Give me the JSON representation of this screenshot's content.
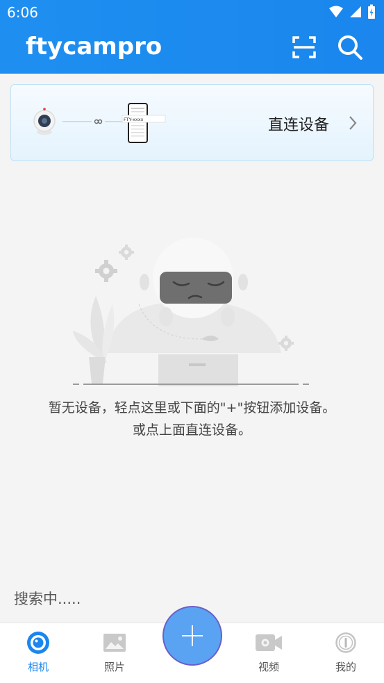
{
  "status_bar": {
    "time": "6:06"
  },
  "app_bar": {
    "title": "ftycampro"
  },
  "direct_connect": {
    "label": "直连设备",
    "phone_text": "FTY-xxxx"
  },
  "empty_state": {
    "line1": "暂无设备，轻点这里或下面的\"+\"按钮添加设备。",
    "line2": "或点上面直连设备。"
  },
  "search_status": "搜索中.....",
  "bottom_nav": {
    "items": [
      {
        "label": "相机",
        "icon": "camera-icon",
        "active": true
      },
      {
        "label": "照片",
        "icon": "photo-icon",
        "active": false
      },
      {
        "label": "视频",
        "icon": "video-icon",
        "active": false
      },
      {
        "label": "我的",
        "icon": "info-icon",
        "active": false
      }
    ]
  },
  "colors": {
    "app_bar": "#1a86ee",
    "accent": "#1a86ee",
    "fab": "#5aa3f2",
    "background": "#f4f4f4"
  }
}
